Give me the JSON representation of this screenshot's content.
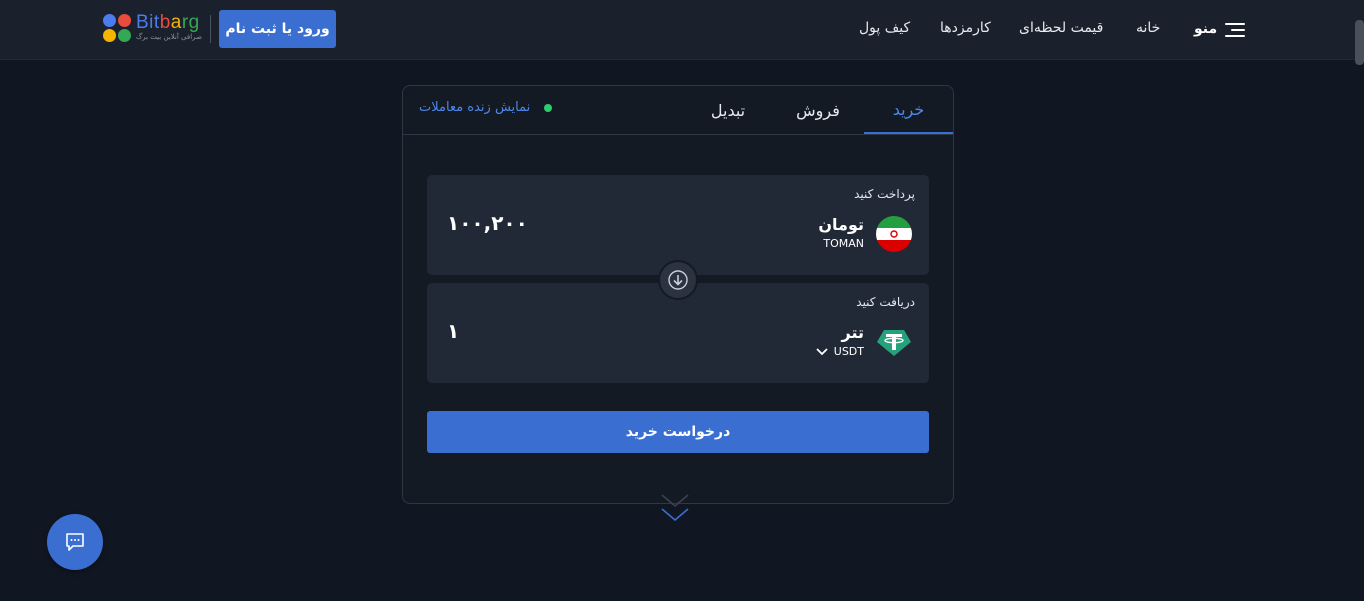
{
  "header": {
    "menu_label": "منو",
    "nav": {
      "home": "خانه",
      "live_price": "قیمت لحظه‌ای",
      "fees": "کارمزدها",
      "wallet": "کیف پول"
    },
    "login_label": "ورود یا ثبت نام",
    "logo": {
      "brand_parts": [
        "Bit",
        "b",
        "a",
        "rg"
      ],
      "tagline": "صرافی آنلاین بیت برگ"
    }
  },
  "trade": {
    "tabs": {
      "buy": "خرید",
      "sell": "فروش",
      "convert": "تبدیل"
    },
    "active_tab": "buy",
    "live_trades_label": "نمایش زنده معاملات",
    "pay": {
      "label": "پرداخت کنید",
      "currency_name": "تومان",
      "currency_code": "TOMAN",
      "amount": "۱۰۰,۲۰۰",
      "icon": "iran-flag-icon"
    },
    "receive": {
      "label": "دریافت کنید",
      "currency_name": "تتر",
      "currency_code": "USDT",
      "amount": "۱",
      "icon": "tether-icon"
    },
    "submit_label": "درخواست خرید"
  },
  "colors": {
    "accent": "#3a6ed1",
    "background": "#111722",
    "live_dot": "#2ecc71",
    "tether": "#26a17b"
  }
}
